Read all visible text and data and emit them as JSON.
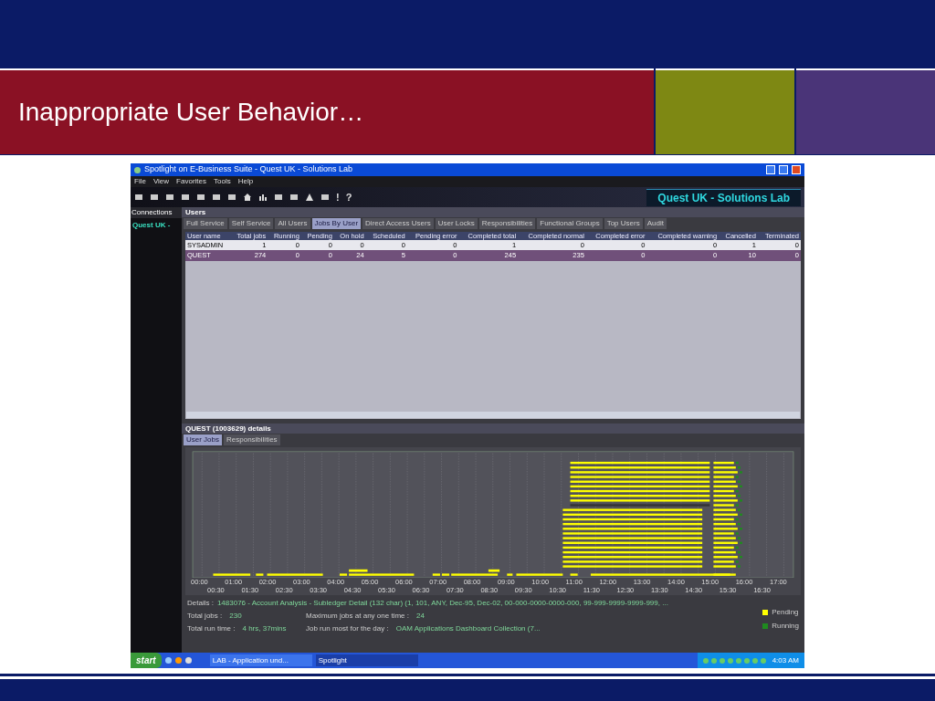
{
  "slide": {
    "title": "Inappropriate User Behavior…"
  },
  "window": {
    "title": "Spotlight on E-Business Suite - Quest UK - Solutions Lab",
    "menu": [
      "File",
      "View",
      "Favorites",
      "Tools",
      "Help"
    ],
    "toolbar_glyphs": [
      "!",
      "?"
    ],
    "brand": "Quest UK - Solutions Lab"
  },
  "sidebar": {
    "title": "Connections",
    "items": [
      {
        "label": "Quest UK -"
      }
    ]
  },
  "users_panel": {
    "title": "Users",
    "tabs": [
      {
        "label": "Full Service",
        "selected": false
      },
      {
        "label": "Self Service",
        "selected": false
      },
      {
        "label": "All Users",
        "selected": false
      },
      {
        "label": "Jobs By User",
        "selected": true
      },
      {
        "label": "Direct Access Users",
        "selected": false
      },
      {
        "label": "User Locks",
        "selected": false
      },
      {
        "label": "Responsibilities",
        "selected": false
      },
      {
        "label": "Functional Groups",
        "selected": false
      },
      {
        "label": "Top Users",
        "selected": false
      },
      {
        "label": "Audit",
        "selected": false
      }
    ],
    "table": {
      "columns": [
        "User name",
        "Total jobs",
        "Running",
        "Pending",
        "On hold",
        "Scheduled",
        "Pending error",
        "Completed total",
        "Completed normal",
        "Completed error",
        "Completed warning",
        "Cancelled",
        "Terminated"
      ],
      "rows": [
        {
          "selected": false,
          "cells": [
            "SYSADMIN",
            "1",
            "0",
            "0",
            "0",
            "0",
            "0",
            "1",
            "0",
            "0",
            "0",
            "1",
            "0"
          ]
        },
        {
          "selected": true,
          "cells": [
            "QUEST",
            "274",
            "0",
            "0",
            "24",
            "5",
            "0",
            "245",
            "235",
            "0",
            "0",
            "10",
            "0"
          ]
        }
      ]
    }
  },
  "details_panel": {
    "title": "QUEST (1003629) details",
    "tabs": [
      {
        "label": "User Jobs",
        "selected": true
      },
      {
        "label": "Responsibilities",
        "selected": false
      }
    ],
    "time_labels": [
      "00:00",
      "00:30",
      "01:00",
      "01:30",
      "02:00",
      "02:30",
      "03:00",
      "03:30",
      "04:00",
      "04:30",
      "05:00",
      "05:30",
      "06:00",
      "06:30",
      "07:00",
      "07:30",
      "08:00",
      "08:30",
      "09:00",
      "09:30",
      "10:00",
      "10:30",
      "11:00",
      "11:30",
      "12:00",
      "12:30",
      "13:00",
      "13:30",
      "14:00",
      "14:30",
      "15:00",
      "15:30",
      "16:00",
      "16:30",
      "17:00"
    ],
    "details": {
      "label": "Details :",
      "value": "1483076 - Account Analysis - Subledger Detail (132 char) (1, 101, ANY, Dec-95, Dec-02, 00-000-0000-0000-000, 99-999-9999-9999-999, ..."
    },
    "stats": [
      [
        {
          "label": "Total jobs :",
          "value": "230"
        },
        {
          "label": "Maximum jobs at any one time :",
          "value": "24"
        }
      ],
      [
        {
          "label": "Total run time :",
          "value": "4 hrs, 37mins"
        },
        {
          "label": "Job run most for the day :",
          "value": "OAM Applications Dashboard Collection (7..."
        }
      ]
    ],
    "legend": [
      {
        "label": "Pending",
        "color": "#ffff00"
      },
      {
        "label": "Running",
        "color": "#1f8a1f"
      }
    ]
  },
  "taskbar": {
    "start": "start",
    "windows": [
      {
        "label": "LAB - Application und...",
        "selected": false
      },
      {
        "label": "Spotlight",
        "selected": true
      }
    ],
    "clock": "4:03 AM"
  }
}
